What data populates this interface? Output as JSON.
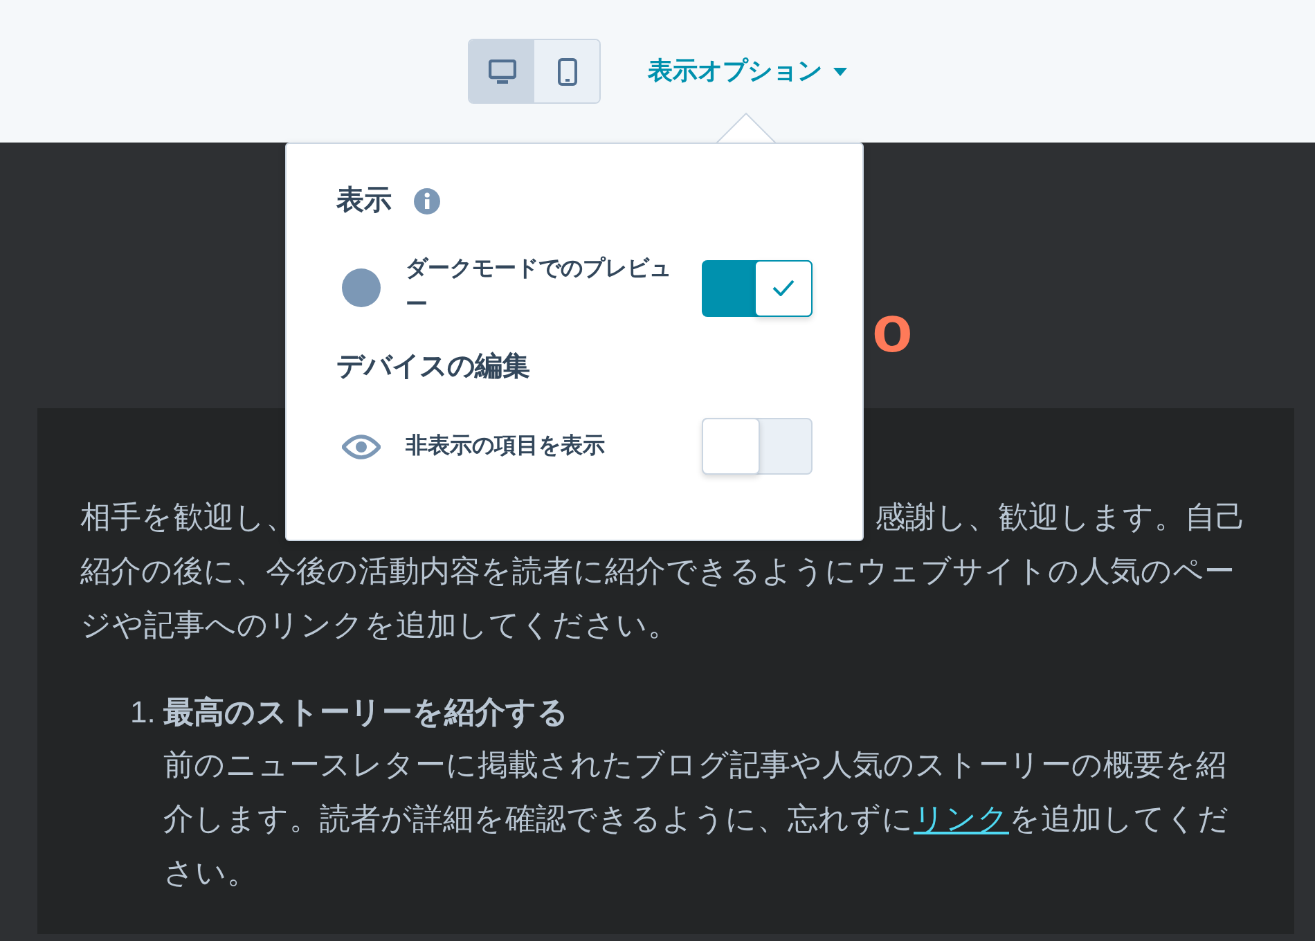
{
  "view_switcher": [
    {
      "selected": true
    },
    {
      "selected": false
    }
  ],
  "options_menu": {
    "label": "表示オプション"
  },
  "popover": {
    "sections": [
      {
        "title": "表示",
        "info": true,
        "items": [
          {
            "label": "ダークモードでのプレビュー",
            "on": true
          }
        ]
      },
      {
        "title": "デバイスの編集",
        "info": false,
        "items": [
          {
            "label": "非表示の項目を表示",
            "on": false
          }
        ]
      }
    ]
  },
  "preview": {
    "logo": "o",
    "intro_lines": [
      [
        "相手を歓迎し、",
        "感謝し、歓迎します。自己"
      ],
      [
        "紹介の後に、今後の活動内容を読者に紹介できるようにウェブサイトの人気のペー"
      ],
      [
        "ジや記事へのリンクを追加してください。"
      ]
    ],
    "list": [
      {
        "number": "1.",
        "title": "最高のストーリーを紹介する",
        "before": "前のニュースレターに掲載されたブログ記事や人気のストーリーの概要を紹介します。読者が詳細を確認できるように、忘れずに",
        "link": "リンク",
        "after": "を追加してください。"
      }
    ]
  }
}
